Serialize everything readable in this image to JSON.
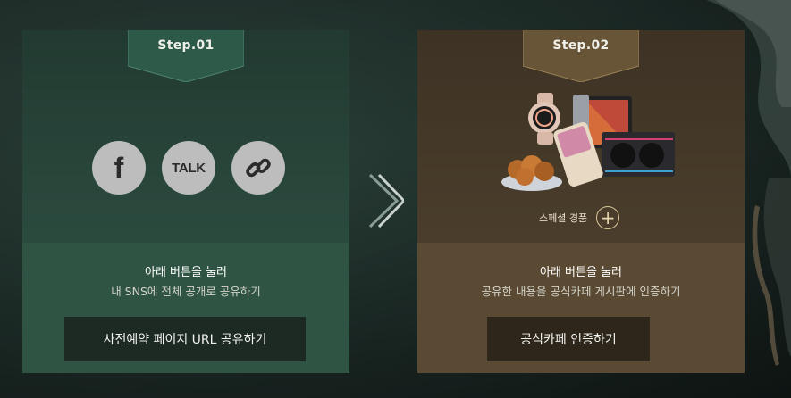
{
  "step1": {
    "badge": "Step.01",
    "share_icons": [
      "facebook-icon",
      "kakaotalk-icon",
      "link-icon"
    ],
    "talk_label": "TALK",
    "fb_label": "f",
    "desc_line1": "아래 버튼을 눌러",
    "desc_line2": "내 SNS에 전체 공개로 공유하기",
    "button_label": "사전예약 페이지 URL 공유하기"
  },
  "step2": {
    "badge": "Step.02",
    "special_label": "스페셜 경품",
    "plus_label": "+",
    "desc_line1": "아래 버튼을 눌러",
    "desc_line2": "공유한 내용을 공식카페 게시판에 인증하기",
    "button_label": "공식카페 인증하기"
  },
  "colors": {
    "step1_bg": "#2b4a3e",
    "step2_bg": "#4a3d2b",
    "icon_circle": "#bdbdbd"
  }
}
